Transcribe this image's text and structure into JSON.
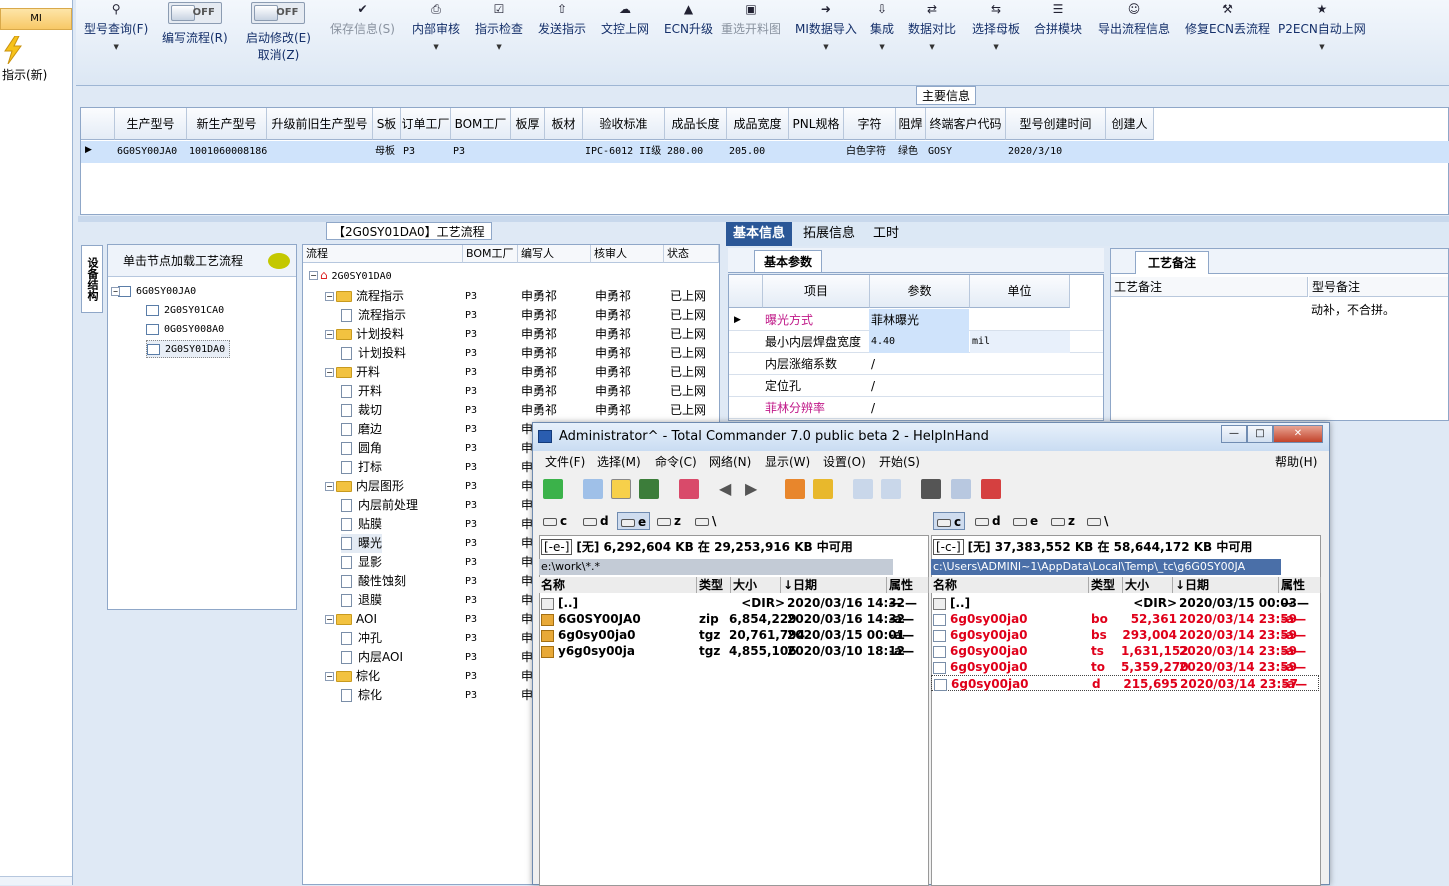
{
  "left": {
    "tab": "MI",
    "indicator_label": "指示(新)"
  },
  "ribbon": {
    "items": [
      {
        "label": "型号查询(F)",
        "icon": "search-icon"
      },
      {
        "label": "编写流程(R)",
        "toggle": "OFF"
      },
      {
        "label": "启动修改(E)",
        "label2": "取消(Z)",
        "toggle": "OFF"
      },
      {
        "label": "保存信息(S)",
        "icon": "check-icon",
        "disabled": true
      },
      {
        "label": "内部审核",
        "icon": "printer-icon"
      },
      {
        "label": "指示检查",
        "icon": "checklist-icon"
      },
      {
        "label": "发送指示",
        "icon": "upload-icon"
      },
      {
        "label": "文控上网",
        "icon": "cloud-upload-icon"
      },
      {
        "label": "ECN升级",
        "icon": "ab-icon"
      },
      {
        "label": "重选开料图",
        "icon": "image-icon",
        "disabled": true
      },
      {
        "label": "MI数据导入",
        "icon": "import-icon"
      },
      {
        "label": "集成",
        "icon": "download-icon"
      },
      {
        "label": "数据对比",
        "icon": "compare-icon"
      },
      {
        "label": "选择母板",
        "icon": "shuffle-icon"
      },
      {
        "label": "合拼模块",
        "icon": "list-icon"
      },
      {
        "label": "导出流程信息",
        "icon": "smile-icon"
      },
      {
        "label": "修复ECN丢流程",
        "icon": "wrench-icon"
      },
      {
        "label": "P2ECN自动上网",
        "icon": "star-icon"
      }
    ]
  },
  "main": {
    "legend": "主要信息",
    "columns": [
      "生产型号",
      "新生产型号",
      "升级前旧生产型号",
      "S板",
      "订单工厂",
      "BOM工厂",
      "板厚",
      "板材",
      "验收标准",
      "成品长度",
      "成品宽度",
      "PNL规格",
      "字符",
      "阻焊",
      "终端客户代码",
      "型号创建时间",
      "创建人"
    ],
    "row": [
      "6G0SY00JA0",
      "10010600081863",
      "",
      "母板",
      "P3",
      "P3",
      "",
      "",
      "IPC-6012 II级",
      "280.00",
      "205.00",
      "",
      "白色字符",
      "绿色",
      "GOSY",
      "2020/3/10",
      ""
    ]
  },
  "process": {
    "title": "【2G0SY01DA0】工艺流程",
    "side_tab": "设备结构",
    "tree_header": "单击节点加载工艺流程",
    "tree": [
      "6G0SY00JA0",
      "2G0SY01CA0",
      "0G0SY008A0",
      "2G0SY01DA0"
    ],
    "flow_columns": [
      "流程",
      "BOM工厂",
      "编写人",
      "核审人",
      "状态"
    ],
    "flow_root": "2G0SY01DA0",
    "flow_rows": [
      {
        "name": "流程指示",
        "level": 1,
        "folder": true,
        "bom": "P3",
        "writer": "申勇祁",
        "reviewer": "申勇祁",
        "status": "已上网"
      },
      {
        "name": "流程指示",
        "level": 2,
        "folder": false,
        "bom": "P3",
        "writer": "申勇祁",
        "reviewer": "申勇祁",
        "status": "已上网"
      },
      {
        "name": "计划投料",
        "level": 1,
        "folder": true,
        "bom": "P3",
        "writer": "申勇祁",
        "reviewer": "申勇祁",
        "status": "已上网"
      },
      {
        "name": "计划投料",
        "level": 2,
        "folder": false,
        "bom": "P3",
        "writer": "申勇祁",
        "reviewer": "申勇祁",
        "status": "已上网"
      },
      {
        "name": "开料",
        "level": 1,
        "folder": true,
        "bom": "P3",
        "writer": "申勇祁",
        "reviewer": "申勇祁",
        "status": "已上网"
      },
      {
        "name": "开料",
        "level": 2,
        "folder": false,
        "bom": "P3",
        "writer": "申勇祁",
        "reviewer": "申勇祁",
        "status": "已上网"
      },
      {
        "name": "裁切",
        "level": 2,
        "folder": false,
        "bom": "P3",
        "writer": "申勇祁",
        "reviewer": "申勇祁",
        "status": "已上网"
      },
      {
        "name": "磨边",
        "level": 2,
        "folder": false,
        "bom": "P3",
        "writer": "申",
        "reviewer": "",
        "status": ""
      },
      {
        "name": "圆角",
        "level": 2,
        "folder": false,
        "bom": "P3",
        "writer": "申",
        "reviewer": "",
        "status": ""
      },
      {
        "name": "打标",
        "level": 2,
        "folder": false,
        "bom": "P3",
        "writer": "申",
        "reviewer": "",
        "status": ""
      },
      {
        "name": "内层图形",
        "level": 1,
        "folder": true,
        "bom": "P3",
        "writer": "申",
        "reviewer": "",
        "status": ""
      },
      {
        "name": "内层前处理",
        "level": 2,
        "folder": false,
        "bom": "P3",
        "writer": "申",
        "reviewer": "",
        "status": ""
      },
      {
        "name": "贴膜",
        "level": 2,
        "folder": false,
        "bom": "P3",
        "writer": "申",
        "reviewer": "",
        "status": ""
      },
      {
        "name": "曝光",
        "level": 2,
        "folder": false,
        "bom": "P3",
        "writer": "申",
        "reviewer": "",
        "status": ""
      },
      {
        "name": "显影",
        "level": 2,
        "folder": false,
        "bom": "P3",
        "writer": "申",
        "reviewer": "",
        "status": ""
      },
      {
        "name": "酸性蚀刻",
        "level": 2,
        "folder": false,
        "bom": "P3",
        "writer": "申",
        "reviewer": "",
        "status": ""
      },
      {
        "name": "退膜",
        "level": 2,
        "folder": false,
        "bom": "P3",
        "writer": "申",
        "reviewer": "",
        "status": ""
      },
      {
        "name": "AOI",
        "level": 1,
        "folder": true,
        "bom": "P3",
        "writer": "申",
        "reviewer": "",
        "status": ""
      },
      {
        "name": "冲孔",
        "level": 2,
        "folder": false,
        "bom": "P3",
        "writer": "申",
        "reviewer": "",
        "status": ""
      },
      {
        "name": "内层AOI",
        "level": 2,
        "folder": false,
        "bom": "P3",
        "writer": "申",
        "reviewer": "",
        "status": ""
      },
      {
        "name": "棕化",
        "level": 1,
        "folder": true,
        "bom": "P3",
        "writer": "申",
        "reviewer": "",
        "status": ""
      },
      {
        "name": "棕化",
        "level": 2,
        "folder": false,
        "bom": "P3",
        "writer": "申",
        "reviewer": "",
        "status": ""
      }
    ]
  },
  "info": {
    "tabs": [
      "基本信息",
      "拓展信息",
      "工时"
    ],
    "basic_sub": "基本参数",
    "columns": [
      "项目",
      "参数",
      "单位"
    ],
    "rows": [
      {
        "item": "曝光方式",
        "value": "菲林曝光",
        "unit": "",
        "pink": true
      },
      {
        "item": "最小内层焊盘宽度",
        "value": "4.40",
        "unit": "mil",
        "pink": false
      },
      {
        "item": "内层涨缩系数",
        "value": "/",
        "unit": "",
        "pink": false
      },
      {
        "item": "定位孔",
        "value": "/",
        "unit": "",
        "pink": false
      },
      {
        "item": "菲林分辨率",
        "value": "/",
        "unit": "",
        "pink": true
      }
    ],
    "note_tab": "工艺备注",
    "note_col1": "工艺备注",
    "note_col2": "型号备注",
    "note_text": "动补，不合拼。"
  },
  "tc": {
    "title": "Administrator^ - Total Commander 7.0 public beta 2 - HelpInHand",
    "menu": [
      "文件(F)",
      "选择(M)",
      "命令(C)",
      "网络(N)",
      "显示(W)",
      "设置(O)",
      "开始(S)"
    ],
    "help": "帮助(H)",
    "drives": [
      "c",
      "d",
      "e",
      "z",
      "\\"
    ],
    "left": {
      "drive": "[-e-]",
      "info": "[无]  6,292,604 KB 在 29,253,916 KB 中可用",
      "path": "e:\\work\\*.*",
      "cols": [
        "名称",
        "类型",
        "大小",
        "↓日期",
        "属性"
      ],
      "files": [
        {
          "name": "[..]",
          "type": "",
          "size": "<DIR>",
          "date": "2020/03/16 14:32—",
          "attr": "—"
        },
        {
          "name": "6G0SY00JA0",
          "type": "zip",
          "size": "6,854,229",
          "date": "2020/03/16 14:32",
          "attr": "-a—"
        },
        {
          "name": "6g0sy00ja0",
          "type": "tgz",
          "size": "20,761,794",
          "date": "2020/03/15 00:01",
          "attr": "-a—"
        },
        {
          "name": "y6g0sy00ja",
          "type": "tgz",
          "size": "4,855,106",
          "date": "2020/03/10 18:12",
          "attr": "-a—"
        }
      ]
    },
    "right": {
      "drive": "[-c-]",
      "info": "[无]  37,383,552 KB 在 58,644,172 KB 中可用",
      "path": "c:\\Users\\ADMINI~1\\AppData\\Local\\Temp\\_tc\\g6G0SY00JA",
      "cols": [
        "名称",
        "类型",
        "大小",
        "↓日期",
        "属性"
      ],
      "files": [
        {
          "name": "[..]",
          "type": "",
          "size": "<DIR>",
          "date": "2020/03/15 00:03—",
          "attr": "—"
        },
        {
          "name": "6g0sy00ja0",
          "type": "bo",
          "size": "52,361",
          "date": "2020/03/14 23:59",
          "attr": "-a—"
        },
        {
          "name": "6g0sy00ja0",
          "type": "bs",
          "size": "293,004",
          "date": "2020/03/14 23:59",
          "attr": "-a—"
        },
        {
          "name": "6g0sy00ja0",
          "type": "ts",
          "size": "1,631,152",
          "date": "2020/03/14 23:59",
          "attr": "-a—"
        },
        {
          "name": "6g0sy00ja0",
          "type": "to",
          "size": "5,359,270",
          "date": "2020/03/14 23:59",
          "attr": "-a—"
        },
        {
          "name": "6g0sy00ja0",
          "type": "d",
          "size": "215,695",
          "date": "2020/03/14 23:57",
          "attr": "-a—"
        }
      ]
    }
  }
}
